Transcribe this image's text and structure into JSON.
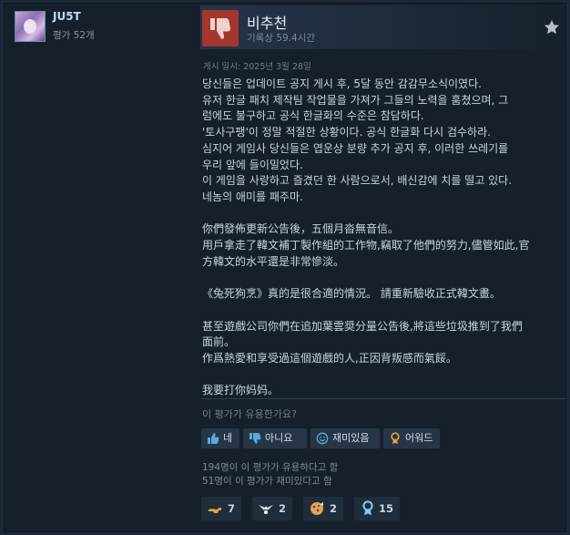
{
  "user": {
    "name": "JU5T",
    "review_count": "평가 52개"
  },
  "header": {
    "verdict": "비추천",
    "hours": "기록상 59.4시간"
  },
  "posted": "게시 일시: 2025년 3월 28일",
  "review_lines": [
    "당신들은 업데이트 공지 게시 후, 5달 동안 감감무소식이였다.",
    "유저 한글 패치 제작팀 작업물을 가져가 그들의 노력을 훔쳤으며, 그",
    "럼에도 불구하고 공식 한글화의 수준은 참담하다.",
    "'토사구팽'이 정말 적절한 상황이다. 공식 한글화 다시 검수하라.",
    "심지어 게임사 당신들은 엽운상 분량 추가 공지 후, 이러한 쓰레기를",
    "우리 앞에 들이밀었다.",
    "이 게임을 사랑하고 즐겼던 한 사람으로서, 배신감에 치를 떨고 있다.",
    "네놈의 애미를 패주마.",
    "",
    "你們發佈更新公告後，五個月沓無音信。",
    "用戶拿走了韓文補丁製作組的工作物,竊取了他們的努力,儘管如此,官",
    "方韓文的水平還是非常慘淡。",
    "",
    "《兔死狗烹》真的是很合適的情況。 請重新驗收正式韓文畫。",
    "",
    "甚至遊戲公司你們在追加葉雲奨分量公告後,將這些垃圾推到了我們",
    "面前。",
    "作爲熱愛和享受過這個遊戲的人,正因背叛感而氣餒。",
    "",
    "我要打你妈妈。"
  ],
  "helpful_question": "이 평가가 유용한가요?",
  "vote_buttons": {
    "yes": "네",
    "no": "아니요",
    "funny": "재미있음",
    "award": "어워드"
  },
  "counts": {
    "helpful": "194명이 이 평가가 유용하다고 함",
    "funny": "51명이 이 평가가 재미있다고 함"
  },
  "awards": [
    {
      "icon": "gun-hand-icon",
      "count": "7"
    },
    {
      "icon": "winged-award-icon",
      "count": "2"
    },
    {
      "icon": "cookie-award-icon",
      "count": "2"
    },
    {
      "icon": "medal-icon",
      "count": "15"
    }
  ],
  "colors": {
    "thumb_down_bg": "#a3362e",
    "award_gold": "#e8a23b",
    "award_blue": "#66c0f4"
  }
}
